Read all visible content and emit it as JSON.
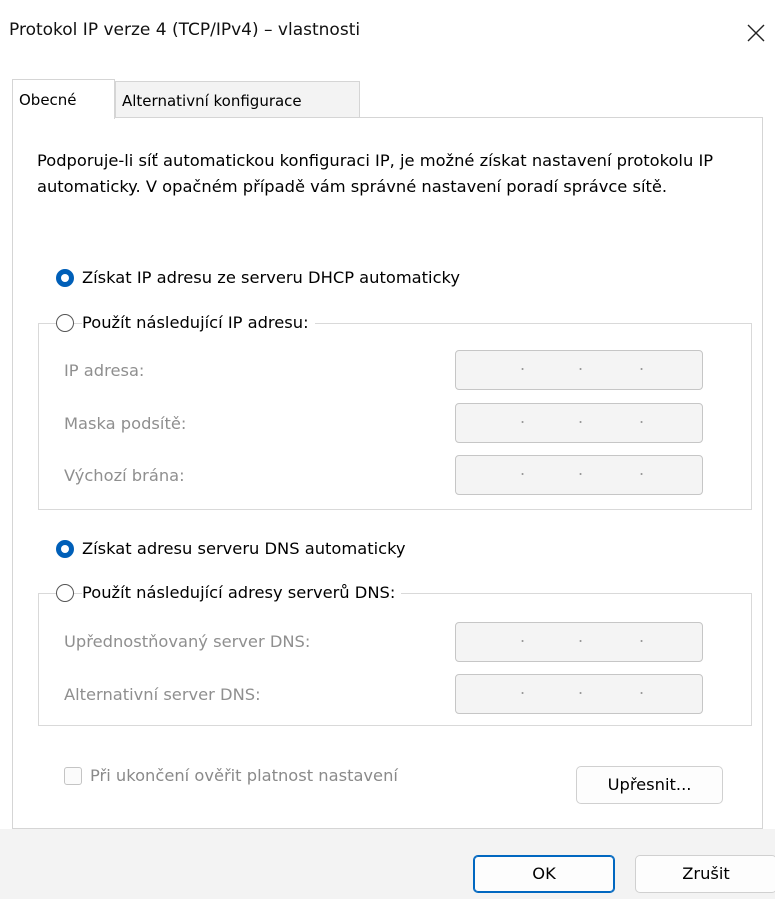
{
  "window": {
    "title": "Protokol IP verze 4 (TCP/IPv4) – vlastnosti"
  },
  "tabs": [
    {
      "label": "Obecné",
      "active": true
    },
    {
      "label": "Alternativní konfigurace",
      "active": false
    }
  ],
  "intro_text": "Podporuje-li síť automatickou konfiguraci IP, je možné získat nastavení protokolu IP automaticky. V opačném případě vám správné nastavení poradí správce sítě.",
  "ip_section": {
    "auto_label": "Získat IP adresu ze serveru DHCP automaticky",
    "auto_selected": true,
    "manual_label": "Použít následující IP adresu:",
    "fields": [
      {
        "label": "IP adresa:",
        "value": " .  .  . "
      },
      {
        "label": "Maska podsítě:",
        "value": " .  .  . "
      },
      {
        "label": "Výchozí brána:",
        "value": " .  .  . "
      }
    ]
  },
  "dns_section": {
    "auto_label": "Získat adresu serveru DNS automaticky",
    "auto_selected": true,
    "manual_label": "Použít následující adresy serverů DNS:",
    "fields": [
      {
        "label": "Upřednostňovaný server DNS:",
        "value": " .  .  . "
      },
      {
        "label": "Alternativní server DNS:",
        "value": " .  .  . "
      }
    ]
  },
  "validate_checkbox": {
    "label": "Při ukončení ověřit platnost nastavení",
    "checked": false
  },
  "buttons": {
    "advanced": "Upřesnit...",
    "ok": "OK",
    "cancel": "Zrušit"
  },
  "colors": {
    "accent": "#005fb8",
    "disabled_text": "#8f8f8f",
    "footer_bg": "#f3f3f3"
  },
  "icons": {
    "close": "close-icon"
  }
}
